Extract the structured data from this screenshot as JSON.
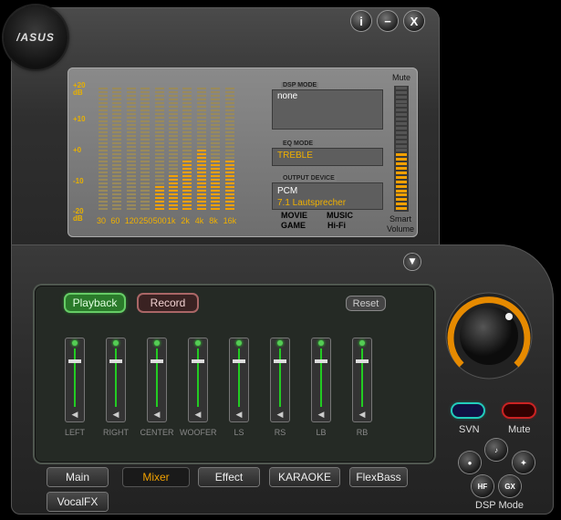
{
  "logo": "/ASUS",
  "window_buttons": {
    "info": "i",
    "minimize": "−",
    "close": "X"
  },
  "eq": {
    "db_labels": [
      "+20\ndB",
      "+10",
      "+0",
      "-10",
      "-20\ndB"
    ],
    "bands": [
      "30",
      "60",
      "120",
      "250",
      "500",
      "1k",
      "2k",
      "4k",
      "8k",
      "16k"
    ],
    "levels_db": [
      -20,
      -20,
      -20,
      -20,
      -12,
      -8,
      -4,
      0,
      -4,
      -4
    ]
  },
  "dsp_mode": {
    "title": "DSP MODE",
    "value": "none"
  },
  "eq_mode": {
    "title": "EQ MODE",
    "value": "TREBLE"
  },
  "output_device": {
    "title": "OUTPUT DEVICE",
    "line1": "PCM",
    "line2": "7.1 Lautsprecher"
  },
  "modes": {
    "movie": "MOVIE",
    "music": "MUSIC",
    "game": "GAME",
    "hifi": "Hi-Fi"
  },
  "volume": {
    "mute_label": "Mute",
    "smart_label": "Smart\nVolume",
    "level": 0.45
  },
  "mixer": {
    "playback": "Playback",
    "record": "Record",
    "reset": "Reset",
    "channels": [
      "LEFT",
      "RIGHT",
      "CENTER",
      "WOOFER",
      "LS",
      "RS",
      "LB",
      "RB"
    ]
  },
  "side": {
    "svn": "SVN",
    "mute": "Mute",
    "dsp_mode": "DSP Mode",
    "hf": "HF",
    "gx": "GX"
  },
  "tabs": {
    "main": "Main",
    "mixer": "Mixer",
    "effect": "Effect",
    "karaoke": "KARAOKE",
    "flexbass": "FlexBass",
    "vocalfx": "VocalFX"
  },
  "colors": {
    "accent": "#f0a000",
    "led_green": "#33cc33",
    "mute_red": "#cc2222",
    "svn_cyan": "#22bbaa"
  }
}
